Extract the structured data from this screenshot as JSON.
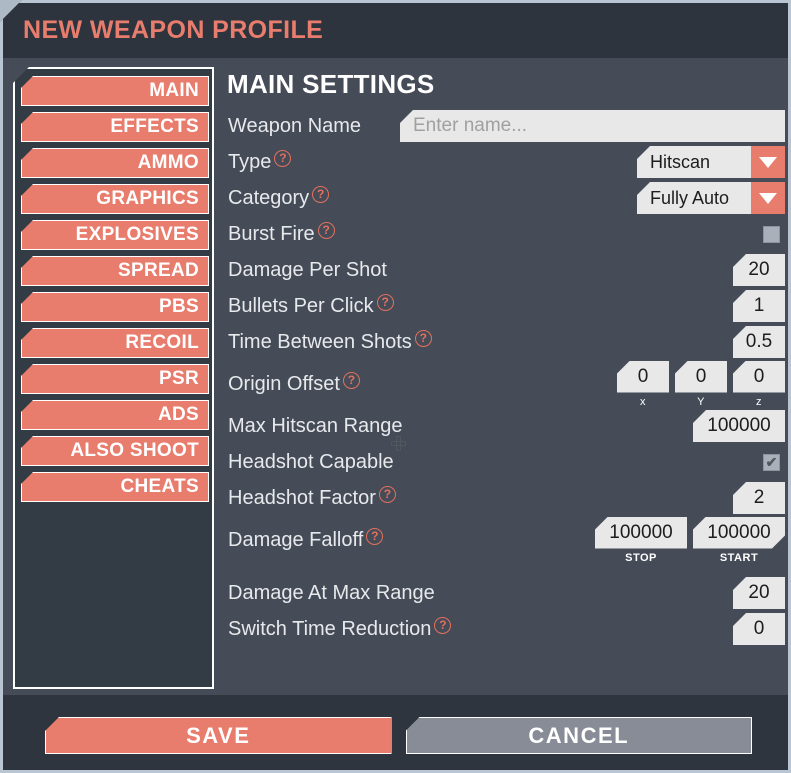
{
  "window": {
    "title": "NEW WEAPON PROFILE",
    "accent_color": "#e87d6d",
    "titlebar_color": "#2d343d",
    "panel_color": "#454c57",
    "sidebar_color": "#333b44",
    "frame_border_color": "#b9c5d2",
    "field_color": "#e8e8e8"
  },
  "sidebar": {
    "items": [
      {
        "label": "MAIN",
        "active": true
      },
      {
        "label": "EFFECTS",
        "active": false
      },
      {
        "label": "AMMO",
        "active": false
      },
      {
        "label": "GRAPHICS",
        "active": false
      },
      {
        "label": "EXPLOSIVES",
        "active": false
      },
      {
        "label": "SPREAD",
        "active": false
      },
      {
        "label": "PBS",
        "active": false
      },
      {
        "label": "RECOIL",
        "active": false
      },
      {
        "label": "PSR",
        "active": false
      },
      {
        "label": "ADS",
        "active": false
      },
      {
        "label": "ALSO SHOOT",
        "active": false
      },
      {
        "label": "CHEATS",
        "active": false
      }
    ]
  },
  "main": {
    "panel_title": "MAIN SETTINGS",
    "help_glyph": "?",
    "fields": {
      "weapon_name": {
        "label": "Weapon Name",
        "value": "",
        "placeholder": "Enter name..."
      },
      "type": {
        "label": "Type",
        "value": "Hitscan",
        "options": [
          "Hitscan"
        ]
      },
      "category": {
        "label": "Category",
        "value": "Fully Auto",
        "options": [
          "Fully Auto"
        ]
      },
      "burst_fire": {
        "label": "Burst Fire",
        "checked": false,
        "check_glyph": ""
      },
      "damage_per_shot": {
        "label": "Damage Per Shot",
        "value": "20"
      },
      "bullets_per_click": {
        "label": "Bullets Per Click",
        "value": "1"
      },
      "time_between_shots": {
        "label": "Time Between Shots",
        "value": "0.5"
      },
      "origin_offset": {
        "label": "Origin Offset",
        "x": {
          "value": "0",
          "sublabel": "x"
        },
        "y": {
          "value": "0",
          "sublabel": "Y"
        },
        "z": {
          "value": "0",
          "sublabel": "z"
        }
      },
      "max_hitscan_range": {
        "label": "Max Hitscan Range",
        "value": "100000"
      },
      "headshot_capable": {
        "label": "Headshot Capable",
        "checked": true,
        "check_glyph": "✔"
      },
      "headshot_factor": {
        "label": "Headshot Factor",
        "value": "2"
      },
      "damage_falloff": {
        "label": "Damage Falloff",
        "stop": {
          "value": "100000",
          "sublabel": "STOP"
        },
        "start": {
          "value": "100000",
          "sublabel": "START"
        }
      },
      "damage_at_max_range": {
        "label": "Damage At Max Range",
        "value": "20"
      },
      "switch_time_reduction": {
        "label": "Switch Time Reduction",
        "value": "0"
      }
    }
  },
  "footer": {
    "save_label": "SAVE",
    "cancel_label": "CANCEL"
  }
}
